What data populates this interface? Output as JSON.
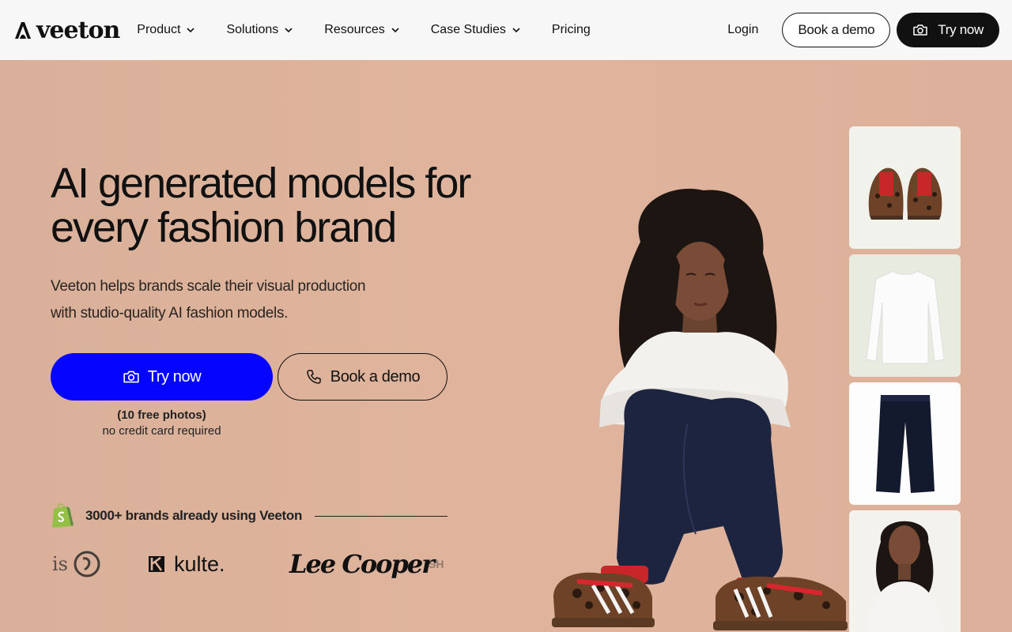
{
  "header": {
    "logo_text": "veeton",
    "nav": [
      {
        "label": "Product",
        "has_dropdown": true
      },
      {
        "label": "Solutions",
        "has_dropdown": true
      },
      {
        "label": "Resources",
        "has_dropdown": true
      },
      {
        "label": "Case Studies",
        "has_dropdown": true
      },
      {
        "label": "Pricing",
        "has_dropdown": false
      }
    ],
    "login_label": "Login",
    "book_demo_label": "Book a demo",
    "try_now_label": "Try now",
    "try_now_icon": "camera-icon"
  },
  "hero": {
    "title_line1": "AI generated models for",
    "title_line2": "every fashion brand",
    "subtitle_line1": "Veeton helps brands scale their visual production",
    "subtitle_line2": "with studio-quality AI fashion models.",
    "primary_cta": {
      "label": "Try now",
      "icon": "camera-icon"
    },
    "secondary_cta": {
      "label": "Book a demo",
      "icon": "phone-icon"
    },
    "free_note_line1": "(10 free photos)",
    "free_note_line2": "no credit card required",
    "brands_text": "3000+ brands already using Veeton",
    "brand_logos": [
      {
        "text": "is",
        "name": "iso"
      },
      {
        "text": "kulte.",
        "name": "kulte"
      },
      {
        "text": "Lee Cooper",
        "name": "lee-cooper"
      },
      {
        "text": "SH",
        "name": "sh"
      }
    ]
  },
  "product_cards": [
    {
      "name": "sneakers"
    },
    {
      "name": "long-sleeve-tee"
    },
    {
      "name": "jeans"
    },
    {
      "name": "model"
    }
  ],
  "colors": {
    "accent": "#0505FF",
    "hero_bg": "#E0B49C",
    "header_bg": "#F7F7F7",
    "dark": "#111111"
  }
}
